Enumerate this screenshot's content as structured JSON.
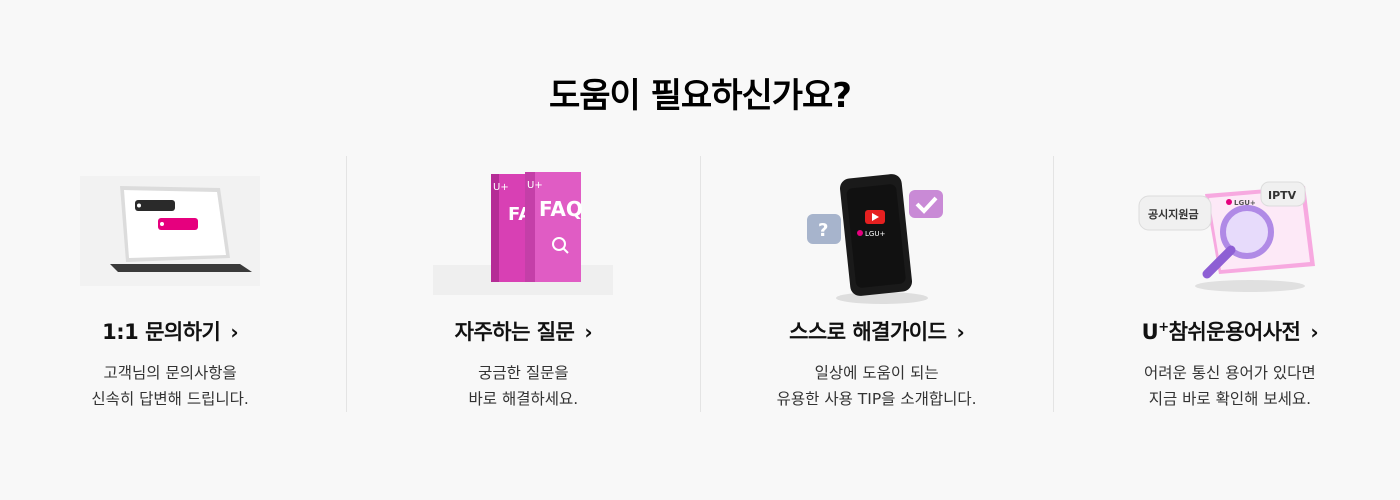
{
  "heading": "도움이 필요하신가요?",
  "colors": {
    "brand": "#e6007e",
    "magenta_light": "#f36ccd",
    "background": "#f8f8f8"
  },
  "cards": [
    {
      "title": "1:1 문의하기",
      "chevron": "›",
      "desc": [
        "고객님의 문의사항을",
        "신속히 답변해 드립니다."
      ],
      "icon": "tablet-chat-icon"
    },
    {
      "title": "자주하는 질문",
      "chevron": "›",
      "desc": [
        "궁금한 질문을",
        "바로 해결하세요."
      ],
      "icon": "faq-books-icon",
      "illustration_text": {
        "book_label": "FAQ",
        "spine_label": "U+"
      }
    },
    {
      "title": "스스로 해결가이드",
      "chevron": "›",
      "desc": [
        "일상에 도움이 되는",
        "유용한 사용 TIP을 소개합니다."
      ],
      "icon": "phone-guide-icon",
      "illustration_text": {
        "screen_logo": "LGU+",
        "question_bubble": "?"
      }
    },
    {
      "title_main": "U",
      "title_sup": "+",
      "title_rest": "참쉬운용어사전",
      "chevron": "›",
      "desc": [
        "어려운 통신 용어가 있다면",
        "지금 바로 확인해 보세요."
      ],
      "icon": "dictionary-magnifier-icon",
      "illustration_text": {
        "bubble_left": "공시지원금",
        "bubble_right": "IPTV",
        "book_logo": "LGU+"
      }
    }
  ]
}
